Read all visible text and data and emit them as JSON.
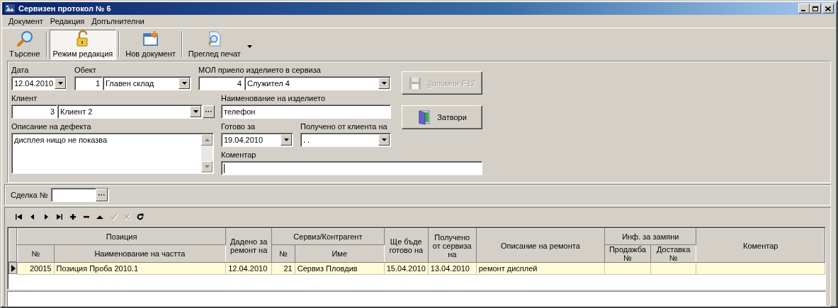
{
  "window": {
    "title": "Сервизен протокол № 6"
  },
  "menu": [
    {
      "label": "Документ"
    },
    {
      "label": "Редакция"
    },
    {
      "label": "Допълнителни"
    }
  ],
  "toolbar": [
    {
      "kind": "search",
      "label": "Търсене",
      "selected": false
    },
    {
      "kind": "lock",
      "label": "Режим редакция",
      "selected": true
    },
    {
      "kind": "new",
      "label": "Нов документ",
      "selected": false
    },
    {
      "kind": "preview",
      "label": "Преглед печат",
      "selected": false,
      "dropdown": true
    }
  ],
  "form": {
    "date": {
      "label": "Дата",
      "value": "12.04.2010"
    },
    "object": {
      "label": "Обект",
      "code": "1",
      "value": "Главен склад"
    },
    "mol": {
      "label": "МОЛ приело изделието в сервиза",
      "code": "4",
      "value": "Служител 4"
    },
    "client": {
      "label": "Клиент",
      "code": "3",
      "value": "Клиент 2"
    },
    "product": {
      "label": "Наименование на изделието",
      "value": "телефон"
    },
    "defect": {
      "label": "Описание на дефекта",
      "value": "дисплея нищо не показва"
    },
    "ready": {
      "label": "Готово за",
      "value": "19.04.2010"
    },
    "received": {
      "label": "Получено от клиента на",
      "value": ". ."
    },
    "comment": {
      "label": "Коментар"
    },
    "save_button": {
      "label": "Запомни",
      "shortcut": "F12",
      "disabled": true
    },
    "close_button": {
      "label": "Затвори",
      "disabled": false
    }
  },
  "deal": {
    "label": "Сделка №"
  },
  "navigator": [
    {
      "kind": "first",
      "disabled": false
    },
    {
      "kind": "prev",
      "disabled": false
    },
    {
      "kind": "next",
      "disabled": false
    },
    {
      "kind": "last",
      "disabled": false
    },
    {
      "kind": "add",
      "disabled": false
    },
    {
      "kind": "delete",
      "disabled": false
    },
    {
      "kind": "up",
      "disabled": false
    },
    {
      "kind": "post",
      "disabled": true
    },
    {
      "kind": "cancel",
      "disabled": true
    },
    {
      "kind": "refresh",
      "disabled": false
    }
  ],
  "table": {
    "columns": [
      {
        "label": "Позиция",
        "colspan": 2,
        "children": [
          {
            "label": "№",
            "numeric": true
          },
          {
            "label": "Наименование на частта"
          }
        ]
      },
      {
        "label": "Дадено за ремонт на"
      },
      {
        "label": "Сервиз/Контрагент",
        "colspan": 2,
        "children": [
          {
            "label": "№",
            "numeric": true
          },
          {
            "label": "Име"
          }
        ]
      },
      {
        "label": "Ще бъде готово на"
      },
      {
        "label": "Получено от сервиза на"
      },
      {
        "label": "Описание на ремонта"
      },
      {
        "label": "Инф. за замяни",
        "colspan": 2,
        "children": [
          {
            "label": "Продажба №"
          },
          {
            "label": "Доставка №"
          }
        ]
      },
      {
        "label": "Коментар"
      }
    ],
    "rows": [
      {
        "selected": true,
        "cells": [
          "20015",
          "Позиция Проба 2010.1",
          "12.04.2010",
          "21",
          "Сервиз Пловдив",
          "15.04.2010",
          "13.04.2010",
          "ремонт дисплей"
        ]
      }
    ]
  }
}
